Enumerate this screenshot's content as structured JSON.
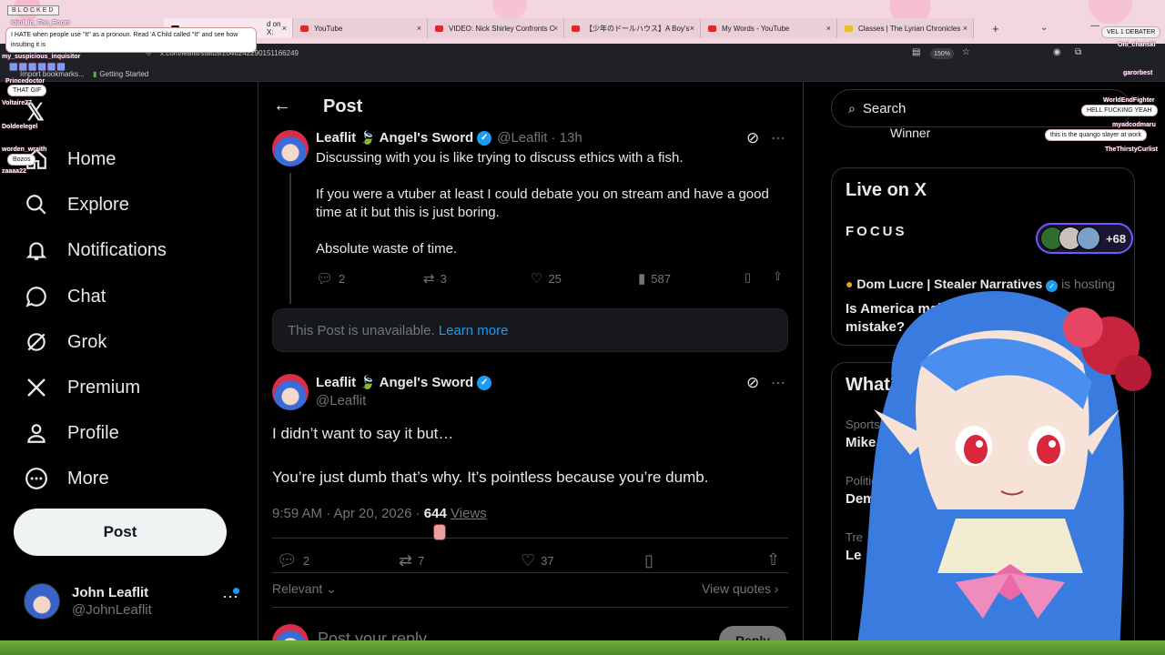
{
  "browser": {
    "tabs": [
      {
        "label": "d on X:",
        "favicon": "x-icon",
        "active": true
      },
      {
        "label": "YouTube",
        "favicon": "youtube-icon"
      },
      {
        "label": "VIDEO: Nick Shirley Confronts C",
        "favicon": "youtube-icon"
      },
      {
        "label": "【少年のドールハウス】A Boy's",
        "favicon": "youtube-icon"
      },
      {
        "label": "My Words - YouTube",
        "favicon": "youtube-icon"
      },
      {
        "label": "Classes | The Lyrian Chronicles",
        "favicon": "classes-icon"
      }
    ],
    "tab_close": "×",
    "new_tab": "+",
    "tab_menu": "⌄",
    "minimize": "—",
    "url": "x.com/leaflit/status/2046242290151166249",
    "zoom": "150%",
    "bookmarks": [
      "Import bookmarks...",
      "Getting Started"
    ]
  },
  "nav": {
    "logo": "𝕏",
    "items": [
      {
        "label": "Home",
        "icon": "home-icon"
      },
      {
        "label": "Explore",
        "icon": "search-icon"
      },
      {
        "label": "Notifications",
        "icon": "bell-icon"
      },
      {
        "label": "Chat",
        "icon": "chat-icon"
      },
      {
        "label": "Grok",
        "icon": "grok-icon"
      },
      {
        "label": "Premium",
        "icon": "x-icon"
      },
      {
        "label": "Profile",
        "icon": "person-icon"
      },
      {
        "label": "More",
        "icon": "more-circle-icon"
      }
    ],
    "post_button": "Post",
    "account": {
      "name": "John Leaflit",
      "handle": "@JohnLeaflit"
    }
  },
  "main": {
    "header": "Post",
    "parent_tweet": {
      "name": "Leaflit",
      "leaf": "🍃",
      "name_suffix": "Angel's Sword",
      "handle": "@Leaflit",
      "time": "· 13h",
      "paragraphs": [
        "Discussing with you is like trying to discuss ethics with a fish.",
        "If you were a vtuber at least I could debate you on stream and have a good time at it but this is just boring.",
        "Absolute waste of time."
      ],
      "replies": "2",
      "reposts": "3",
      "likes": "25",
      "views": "587"
    },
    "unavailable": {
      "text": "This Post is unavailable.",
      "link": "Learn more"
    },
    "main_tweet": {
      "name": "Leaflit",
      "leaf": "🍃",
      "name_suffix": "Angel's Sword",
      "handle": "@Leaflit",
      "line1": "I didn’t want to say it but…",
      "line2": "You’re just dumb that’s why. It’s pointless because you’re dumb.",
      "timestamp": "9:59 AM · Apr 20, 2026 ·",
      "views_count": "644",
      "views_label": "Views",
      "replies": "2",
      "reposts": "7",
      "likes": "37"
    },
    "sort": "Relevant",
    "view_quotes": "View quotes",
    "reply_placeholder": "Post your reply",
    "reply_button": "Reply"
  },
  "sidebar": {
    "search_placeholder": "Search",
    "winner": "Winner",
    "live": {
      "title": "Live on X",
      "focus": "FOCUS",
      "count": "+68",
      "host_name": "Dom Lucre | Stealer",
      "host_name_tail": "Narratives",
      "host_status": "is hosting",
      "space_title": "Is America making a mistake?"
    },
    "whats_title": "What’s",
    "trends": [
      {
        "category": "Sports · T",
        "name": "Mike B"
      },
      {
        "category": "Politic",
        "name": "Dem"
      },
      {
        "category": "Tre",
        "name": "Le"
      }
    ],
    "trend_extra": "es"
  },
  "stream_overlay": {
    "blocked": "BLOCKED",
    "top_chat_user": "Idiot_In_The_Room",
    "top_bubble": "I HATE when people use \"It\" as a pronoun. Read 'A Child called \"It\" and see how insulting it is",
    "chat_users": [
      "my_suspicious_inquisitor",
      "Princedoctor",
      "Voltaire27",
      "Doldeelegel",
      "worden_wraith",
      "zaaaa22"
    ],
    "chat_bubbles": [
      "THAT GIF",
      "Bozos"
    ],
    "right_users": [
      "VEL 1 DEBATER",
      "Oni_chanski",
      "garorbest",
      "WorldEndFighter",
      "myadcodmaru",
      "TheThirstyCurlist"
    ],
    "right_bubbles": [
      "HELL FUCKING YEAH",
      "this is the quango slayer at work"
    ]
  },
  "colors": {
    "accent": "#1d9bf0",
    "background": "#000000",
    "text": "#e7e9ea",
    "muted": "#71767b",
    "live_ring": "#7856ff"
  }
}
